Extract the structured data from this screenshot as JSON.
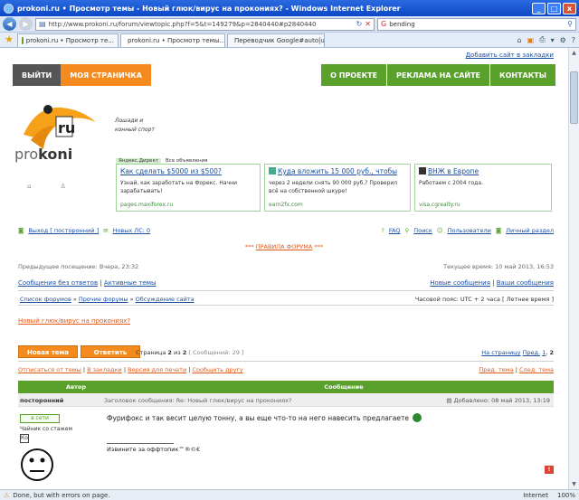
{
  "window": {
    "title": "prokoni.ru • Просмотр темы - Новый глюк/вирус на прокониях? - Windows Internet Explorer",
    "minimize": "_",
    "maximize": "□",
    "close": "x"
  },
  "addressbar": {
    "url": "http://www.prokoni.ru/forum/viewtopic.php?f=5&t=149279&p=2840440#p2840440",
    "search_value": "bending"
  },
  "tabs": [
    {
      "label": "prokoni.ru • Просмотр те...",
      "active": false
    },
    {
      "label": "prokoni.ru • Просмотр темы...",
      "active": true
    },
    {
      "label": "Переводчик Google#auto|ul...",
      "active": false
    }
  ],
  "page": {
    "bookmark_link": "Добавить сайт в закладки",
    "nav": {
      "logout": "ВЫЙТИ",
      "my_page": "МОЯ СТРАНИЧКА",
      "about": "О ПРОЕКТЕ",
      "ads": "РЕКЛАМА НА САЙТЕ",
      "contacts": "КОНТАКТЫ"
    },
    "logo_prefix": "pro",
    "logo_suffix": "koni",
    "logo_badge": "ru",
    "tagline": [
      "Лошади и",
      "конный спорт"
    ],
    "ad_header": {
      "direct": "Яндекс.Директ",
      "all": "Все объявления"
    },
    "ads": [
      {
        "title": "Как сделать $5000 из $500?",
        "text": "Узнай, как заработать на Форекс. Начни зарабатывать!",
        "url": "pages.maxiforex.ru"
      },
      {
        "title": "Куда вложить 15 000 руб., чтобы",
        "text": "через 2 недели снять 90 000 руб.? Проверил всё на собственной шкуре!",
        "url": "earn2fx.com"
      },
      {
        "title": "ВНЖ в Европе",
        "text": "Работаем с 2004 года.",
        "url": "visa.cgrealty.ru"
      }
    ],
    "user_links_left": {
      "logout": "Выход [ посторонний ]",
      "new_pm": "Новых ЛС: 0"
    },
    "user_links_right": {
      "faq": "FAQ",
      "search": "Поиск",
      "users": "Пользователи",
      "pm": "Личный раздел"
    },
    "rules": {
      "stars": "***",
      "label": "ПРАВИЛА ФОРУМА"
    },
    "prev_visit": "Предыдущее посещение: Вчера, 23:32",
    "current_time": "Текущее время: 10 май 2013, 16:53",
    "no_answer": "Сообщения без ответов",
    "active_topics": "Активные темы",
    "new_posts": "Новые сообщения",
    "your_posts": "Ваши сообщения",
    "breadcrumb": [
      "Список форумов",
      "Прочие форумы",
      "Обсуждение сайта"
    ],
    "timezone": "Часовой пояс: UTC + 2 часа [ Летнее время ]",
    "topic_title": "Новый глюк/вирус на прокониях?",
    "new_topic": "Новая тема",
    "reply": "Ответить",
    "page_info": {
      "label": "Страница",
      "current": "2",
      "of": "из",
      "total": "2",
      "count": "[ Сообщений: 29 ]"
    },
    "goto_page": {
      "label": "На страницу",
      "prev": "Пред.",
      "p1": "1",
      "p2": "2"
    },
    "subscribe_row": [
      "Отписаться от темы",
      "В закладки",
      "Версия для печати",
      "Сообщить другу"
    ],
    "prevnext_row": [
      "Пред. тема",
      "След. тема"
    ],
    "table": {
      "author_col": "Автор",
      "message_col": "Сообщение"
    },
    "post": {
      "author": "посторонний",
      "subject": "Заголовок сообщения: Re: Новый глюк/вирус на прокониях?",
      "date": "Добавлено: 08 май 2013, 13:19",
      "online": "в сети",
      "rank": "Чайник со стажем",
      "rank_icon": "Ко",
      "body": "Фурифокс и так весит целую тонну, а вы еще что-то на него навесить предлагаете",
      "signature": "Извините за оффтопик™®©€",
      "report": "!"
    }
  },
  "status": {
    "text": "Done, but with errors on page.",
    "zone": "Internet",
    "zoom": "100%"
  },
  "colors": {
    "green": "#5aa12b",
    "orange": "#f58a1f",
    "dark": "#555555"
  }
}
